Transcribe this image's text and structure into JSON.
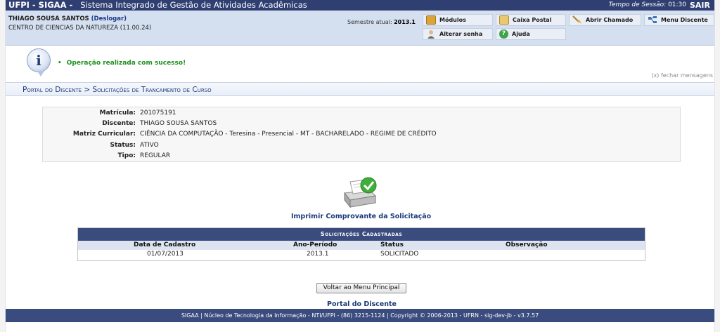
{
  "topbar": {
    "system_name": "UFPI - SIGAA -",
    "system_desc": "Sistema Integrado de Gestão de Atividades Acadêmicas",
    "session_label": "Tempo de Sessão:",
    "session_time": "01:30",
    "logout_label": "SAIR"
  },
  "header": {
    "user_name": "THIAGO SOUSA SANTOS",
    "deslogar": "(Deslogar)",
    "centro": "CENTRO DE CIENCIAS DA NATUREZA (11.00.24)",
    "semestre_label": "Semestre atual:",
    "semestre_value": "2013.1"
  },
  "quick": {
    "modulos": "Módulos",
    "caixa": "Caixa Postal",
    "chamado": "Abrir Chamado",
    "menu": "Menu Discente",
    "senha": "Alterar senha",
    "ajuda": "Ajuda"
  },
  "message": {
    "text": "Operação realizada com sucesso!",
    "close": "(x) fechar mensagens"
  },
  "breadcrumb": "Portal do Discente > Solicitações de Trancamento de Curso",
  "details": [
    {
      "label": "Matrícula:",
      "value": "201075191"
    },
    {
      "label": "Discente:",
      "value": "THIAGO SOUSA SANTOS"
    },
    {
      "label": "Matriz Curricular:",
      "value": "CIÊNCIA DA COMPUTAÇÃO - Teresina - Presencial - MT - BACHARELADO - REGIME DE CRÉDITO"
    },
    {
      "label": "Status:",
      "value": "ATIVO"
    },
    {
      "label": "Tipo:",
      "value": "REGULAR"
    }
  ],
  "print_link": "Imprimir Comprovante da Solicitação",
  "table": {
    "caption": "Solicitações Cadastradas",
    "headers": [
      "Data de Cadastro",
      "Ano-Período",
      "Status",
      "Observação"
    ],
    "rows": [
      [
        "01/07/2013",
        "2013.1",
        "SOLICITADO",
        ""
      ]
    ]
  },
  "voltar_button": "Voltar ao Menu Principal",
  "portal_link": "Portal do Discente",
  "footer": "SIGAA | Núcleo de Tecnologia da Informação - NTI/UFPI - (86) 3215-1124 | Copyright © 2006-2013 - UFRN - sig-dev-jb - v3.7.57"
}
